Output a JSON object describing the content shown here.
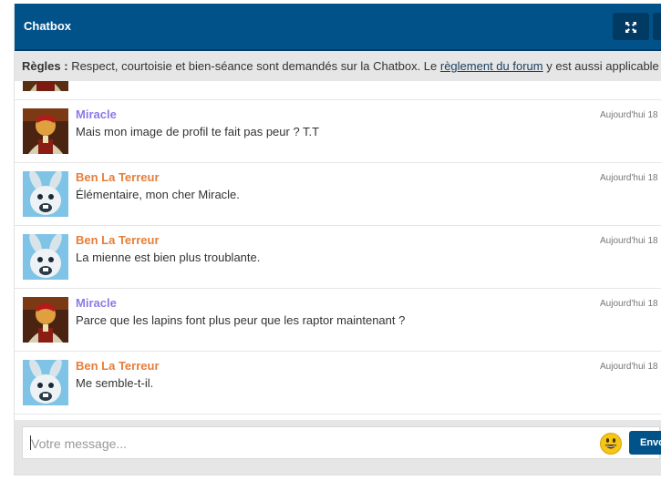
{
  "header": {
    "title": "Chatbox",
    "expand_icon": "expand-arrows-icon"
  },
  "rules": {
    "label": "Règles :",
    "text_before": " Respect, courtoisie et bien-séance sont demandés sur la Chatbox. Le ",
    "link": "règlement du forum",
    "text_after": " y est aussi applicable"
  },
  "colors": {
    "header_bg": "#02528a",
    "miracle": "#8c7ae6",
    "ben": "#e67e3a"
  },
  "messages": [
    {
      "author": "Miracle",
      "text": "Mais mon image de profil te fait pas peur ? T.T",
      "time": "Aujourd'hui 18"
    },
    {
      "author": "Ben La Terreur",
      "text": "Élémentaire, mon cher Miracle.",
      "time": "Aujourd'hui 18"
    },
    {
      "author": "Ben La Terreur",
      "text": "La mienne est bien plus troublante.",
      "time": "Aujourd'hui 18"
    },
    {
      "author": "Miracle",
      "text": "Parce que les lapins font plus peur que les raptor maintenant ?",
      "time": "Aujourd'hui 18"
    },
    {
      "author": "Ben La Terreur",
      "text": "Me semble-t-il.",
      "time": "Aujourd'hui 18"
    }
  ],
  "input": {
    "placeholder": "Votre message...",
    "value": ""
  },
  "send_button": "Envoyer",
  "emoji_icon": "smiley-icon"
}
